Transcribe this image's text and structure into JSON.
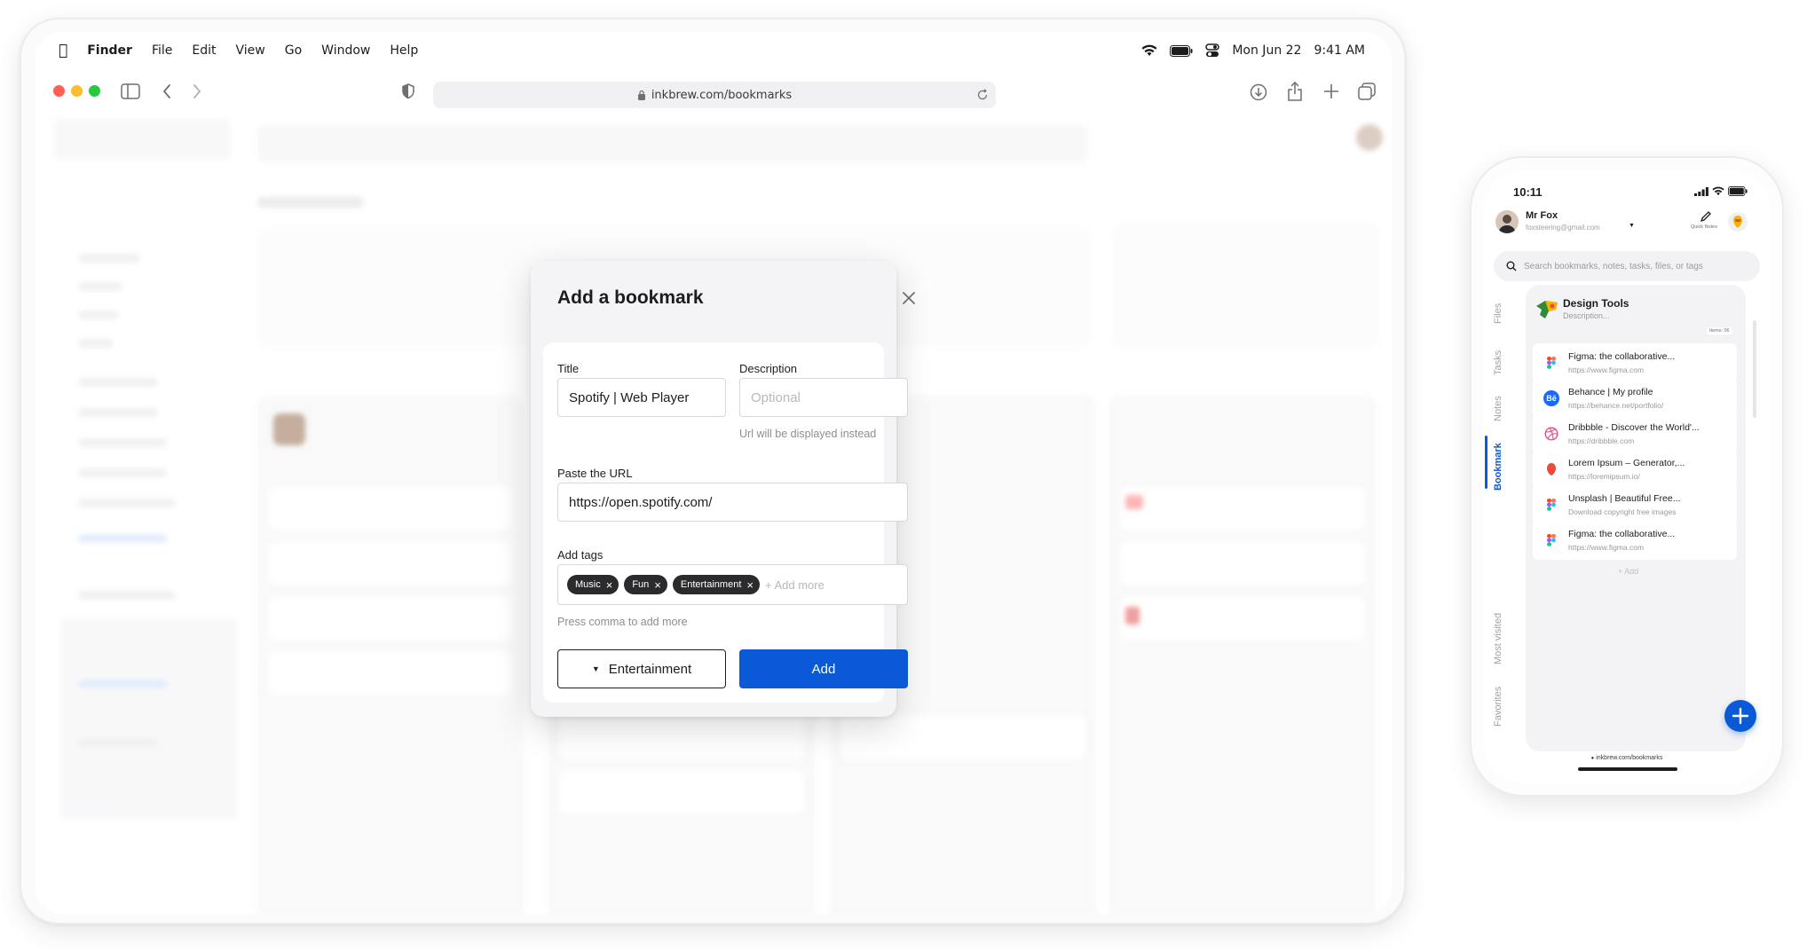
{
  "menubar": {
    "app": "Finder",
    "items": [
      "File",
      "Edit",
      "View",
      "Go",
      "Window",
      "Help"
    ],
    "date": "Mon Jun 22",
    "time": "9:41 AM"
  },
  "browser": {
    "url": "inkbrew.com/bookmarks"
  },
  "modal": {
    "title": "Add a bookmark",
    "title_label": "Title",
    "title_value": "Spotify | Web Player",
    "description_label": "Description",
    "description_placeholder": "Optional",
    "description_hint": "Url will be displayed instead",
    "url_label": "Paste the URL",
    "url_value": "https://open.spotify.com/",
    "tags_label": "Add tags",
    "tags": [
      "Music",
      "Fun",
      "Entertainment"
    ],
    "tags_placeholder": "+ Add more",
    "tags_hint": "Press comma to add more",
    "collection_select": "Entertainment",
    "add_button": "Add"
  },
  "phone": {
    "status_time": "10:11",
    "user_name": "Mr Fox",
    "user_email": "foxsteering@gmail.com",
    "quick_notes_label": "Quick Notes",
    "search_placeholder": "Search bookmarks, notes, tasks, files, or tags",
    "side_tabs": [
      "Files",
      "Tasks",
      "Notes",
      "Bookmark",
      "Most visited",
      "Favorites"
    ],
    "active_tab": "Bookmark",
    "collection": {
      "title": "Design Tools",
      "description": "Description...",
      "items_count": "Items: 06",
      "add_label": "+ Add"
    },
    "bookmarks": [
      {
        "title": "Figma: the collaborative...",
        "url": "https://www.figma.com",
        "icon": "figma-icon"
      },
      {
        "title": "Behance | My profile",
        "url": "https://behance.net/portfolio/",
        "icon": "behance-icon"
      },
      {
        "title": "Dribbble - Discover the World'...",
        "url": "https://dribbble.com",
        "icon": "dribbble-icon"
      },
      {
        "title": "Lorem Ipsum – Generator,...",
        "url": "https://loremipsum.io/",
        "icon": "lorem-icon"
      },
      {
        "title": "Unsplash | Beautiful Free...",
        "url": "Download copyright free images",
        "icon": "figma-icon"
      },
      {
        "title": "Figma: the collaborative...",
        "url": "https://www.figma.com",
        "icon": "figma-icon"
      }
    ],
    "bottom_url": "inkbrew.com/bookmarks"
  },
  "colors": {
    "primary": "#0a5ad8",
    "tag_bg": "#2b2b2d",
    "close_red": "#fe5f57",
    "minimize_yellow": "#febc2e",
    "zoom_green": "#28c840"
  }
}
